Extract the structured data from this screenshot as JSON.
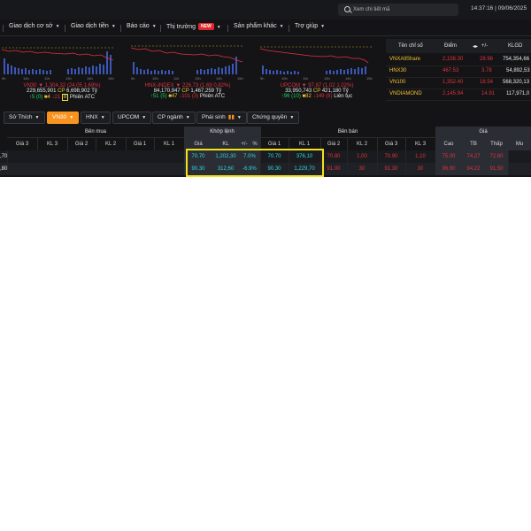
{
  "search": {
    "placeholder": "Xem chi tiết mã"
  },
  "clock": {
    "time": "14:37:16",
    "date": "09/06/2025"
  },
  "menu": [
    {
      "label": "Giao dịch cơ sở"
    },
    {
      "label": "Giao dịch tiền"
    },
    {
      "label": "Báo cáo"
    },
    {
      "label": "Thị trường",
      "badge": "NEW"
    },
    {
      "label": "Sản phẩm khác"
    },
    {
      "label": "Trợ giúp"
    }
  ],
  "indices": [
    {
      "name": "VN30",
      "value": "1,304.32",
      "change": "(24.05 1.69%)",
      "volume": "229,655,901",
      "cp_value": "6,698,902",
      "unit": "Tỷ",
      "up": "5",
      "up_count": "(0)",
      "ref": "4",
      "down": "21",
      "session": "Phiên ATC",
      "axis": [
        "9h",
        "10h",
        "11h",
        "13h",
        "14h",
        "15h"
      ]
    },
    {
      "name": "HNX-INDEX",
      "value": "226.73",
      "change": "(1.69 0.82%)",
      "volume": "84,170,947",
      "cp_value": "1,467,259",
      "unit": "Tỷ",
      "up": "51",
      "up_count": "(5)",
      "ref": "47",
      "down": "101",
      "down_count": "(3)",
      "session": "Phiên ATC",
      "axis": [
        "9h",
        "10h",
        "11h",
        "13h",
        "14h",
        "15h"
      ]
    },
    {
      "name": "UPCOM",
      "value": "97.87",
      "change": "(1.02 1.02%)",
      "volume": "33,950,743",
      "cp_value": "421,180",
      "unit": "Tỷ",
      "up": "96",
      "up_count": "(10)",
      "ref": "82",
      "down": "149",
      "down_count": "(8)",
      "session": "Liên tục",
      "axis": [
        "9h",
        "10h",
        "11h",
        "13h",
        "14h",
        "15h"
      ]
    }
  ],
  "index_table": {
    "headers": [
      "Tên chỉ số",
      "Điểm",
      "+/-",
      "KLGD"
    ],
    "rows": [
      {
        "name": "VNXAllShare",
        "point": "2,156.30",
        "change": "28.96",
        "volume": "754,354,66"
      },
      {
        "name": "HNX30",
        "point": "467.53",
        "change": "3.78",
        "volume": "54,892,53"
      },
      {
        "name": "VN100",
        "point": "1,352.40",
        "change": "18.54",
        "volume": "568,320,13"
      },
      {
        "name": "VNDIAMOND",
        "point": "2,145.94",
        "change": "14.91",
        "volume": "117,971,0"
      }
    ]
  },
  "tabs": [
    {
      "label": "Sở Thích"
    },
    {
      "label": "VN30",
      "active": true
    },
    {
      "label": "HNX"
    },
    {
      "label": "UPCOM"
    },
    {
      "label": "CP ngành"
    },
    {
      "label": "Phái sinh"
    },
    {
      "label": "Chứng quyền"
    }
  ],
  "board": {
    "groups": {
      "buy": "Bên mua",
      "match": "Khớp lệnh",
      "sell": "Bên bán",
      "price": "Giá"
    },
    "columns": [
      "Giá 3",
      "KL 3",
      "Giá 2",
      "KL 2",
      "Giá 1",
      "KL 1",
      "Giá",
      "KL",
      "+/-",
      "%",
      "Giá 1",
      "KL 1",
      "Giá 2",
      "KL 2",
      "Giá 3",
      "KL 3",
      "Cao",
      "TB",
      "Thấp",
      "Mu"
    ],
    "rows": [
      {
        "prefix": ",70",
        "match_price": "70.70",
        "match_vol": "1,202,30",
        "pct": "7.0%",
        "sell1_price": "70.70",
        "sell1_vol": "376,10",
        "sell2_price": "70.80",
        "sell2_vol": "1,00",
        "sell3_price": "70.90",
        "sell3_vol": "1,10",
        "high": "75.00",
        "avg": "74.27",
        "low": "72.60"
      },
      {
        "prefix": ",80",
        "match_price": "90.30",
        "match_vol": "312,60",
        "pct": "-6.9%",
        "sell1_price": "90.30",
        "sell1_vol": "1,229,70",
        "sell2_price": "91.00",
        "sell2_vol": "30",
        "sell3_price": "91.30",
        "sell3_vol": "30",
        "high": "96.90",
        "avg": "94.22",
        "low": "91.50"
      }
    ]
  },
  "colors": {
    "accent": "#f7931e",
    "up": "#1fcf5a",
    "down": "#e0323e",
    "ref": "#f2c230",
    "highlight": "#f3e11a"
  }
}
